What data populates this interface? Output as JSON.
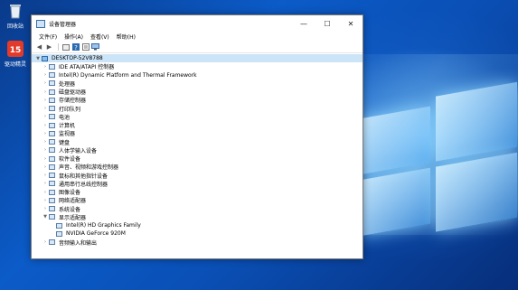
{
  "desktop": {
    "icons": [
      {
        "label": "回收站"
      },
      {
        "label": "驱动精灵"
      }
    ]
  },
  "window": {
    "title": "设备管理器",
    "controls": {
      "minimize": "—",
      "maximize": "☐",
      "close": "✕"
    },
    "menu": [
      "文件(F)",
      "操作(A)",
      "查看(V)",
      "帮助(H)"
    ],
    "toolbar_icons": [
      "back-icon",
      "forward-icon",
      "view-icon",
      "help-icon",
      "properties-icon",
      "monitor-icon"
    ]
  },
  "tree": {
    "root": {
      "label": "DESKTOP-52V8788",
      "expanded": true
    },
    "items": [
      {
        "label": "IDE ATA/ATAPI 控制器",
        "expanded": false
      },
      {
        "label": "Intel(R) Dynamic Platform and Thermal Framework",
        "expanded": false
      },
      {
        "label": "处理器",
        "expanded": false
      },
      {
        "label": "磁盘驱动器",
        "expanded": false
      },
      {
        "label": "存储控制器",
        "expanded": false
      },
      {
        "label": "打印队列",
        "expanded": false
      },
      {
        "label": "电池",
        "expanded": false
      },
      {
        "label": "计算机",
        "expanded": false
      },
      {
        "label": "监视器",
        "expanded": false
      },
      {
        "label": "键盘",
        "expanded": false
      },
      {
        "label": "人体学输入设备",
        "expanded": false
      },
      {
        "label": "软件设备",
        "expanded": false
      },
      {
        "label": "声音、视频和游戏控制器",
        "expanded": false
      },
      {
        "label": "鼠标和其他指针设备",
        "expanded": false
      },
      {
        "label": "通用串行总线控制器",
        "expanded": false
      },
      {
        "label": "图像设备",
        "expanded": false
      },
      {
        "label": "网络适配器",
        "expanded": false
      },
      {
        "label": "系统设备",
        "expanded": false
      },
      {
        "label": "显示适配器",
        "expanded": true,
        "children": [
          {
            "label": "Intel(R) HD Graphics Family"
          },
          {
            "label": "NVIDIA GeForce 920M"
          }
        ]
      },
      {
        "label": "音频输入和输出",
        "expanded": false
      }
    ]
  }
}
